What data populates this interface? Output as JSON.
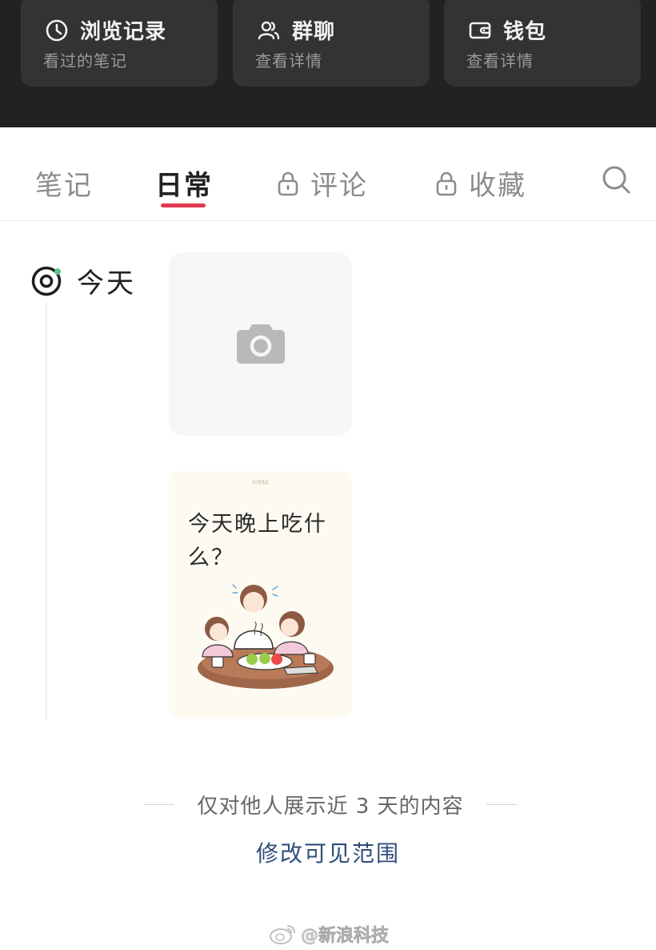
{
  "header_cards": [
    {
      "icon": "clock-icon",
      "title": "浏览记录",
      "subtitle": "看过的笔记"
    },
    {
      "icon": "group-icon",
      "title": "群聊",
      "subtitle": "查看详情"
    },
    {
      "icon": "wallet-icon",
      "title": "钱包",
      "subtitle": "查看详情"
    }
  ],
  "tabs": [
    {
      "label": "笔记",
      "locked": false
    },
    {
      "label": "日常",
      "locked": false,
      "active": true
    },
    {
      "label": "评论",
      "locked": true
    },
    {
      "label": "收藏",
      "locked": true
    }
  ],
  "timeline": {
    "today_label": "今天",
    "post": {
      "watermark": "HIMA",
      "text": "今天晚上吃什么？"
    }
  },
  "footer": {
    "visibility_note": "仅对他人展示近 3 天的内容",
    "edit_link": "修改可见范围"
  },
  "watermark": "@新浪科技",
  "colors": {
    "accent": "#e23a4e",
    "link": "#2f4e7b",
    "dark_header": "#222222"
  }
}
